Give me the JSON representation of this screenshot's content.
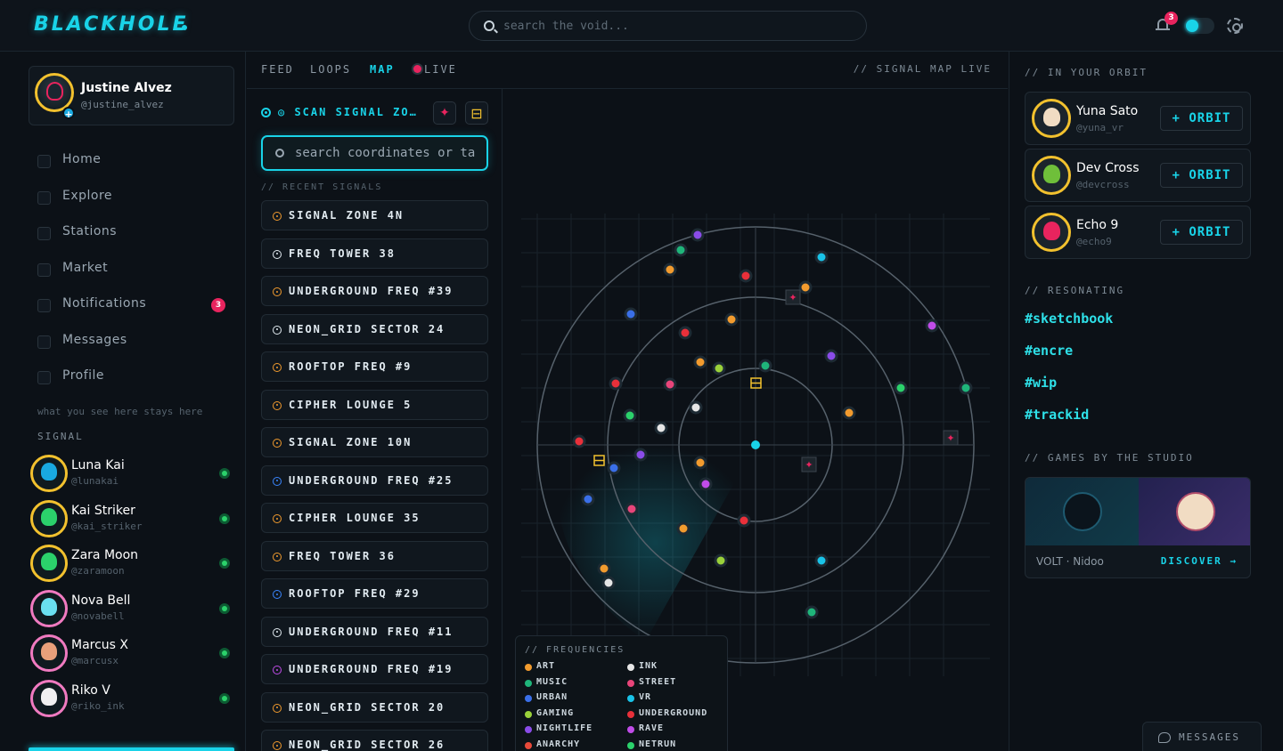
{
  "app": {
    "logo": "BLACKHOLE"
  },
  "search": {
    "placeholder": "search the void..."
  },
  "header": {
    "notifications_count": "3"
  },
  "user": {
    "name": "Justine Alvez",
    "handle": "@justine_alvez"
  },
  "nav": [
    {
      "label": "Home"
    },
    {
      "label": "Explore"
    },
    {
      "label": "Stations"
    },
    {
      "label": "Market"
    },
    {
      "label": "Notifications",
      "badge": "3"
    },
    {
      "label": "Messages"
    },
    {
      "label": "Profile"
    }
  ],
  "tagline": "what you see here stays here",
  "signal_section": "SIGNAL",
  "friends": [
    {
      "name": "Luna Kai",
      "handle": "@lunakai",
      "color": "#19a9e0"
    },
    {
      "name": "Kai Striker",
      "handle": "@kai_striker",
      "color": "#2bd16b"
    },
    {
      "name": "Zara Moon",
      "handle": "@zaramoon",
      "color": "#2bd16b"
    },
    {
      "name": "Nova Bell",
      "handle": "@novabell",
      "color": "#6ae0f0"
    },
    {
      "name": "Marcus X",
      "handle": "@marcusx",
      "color": "#e8a07a"
    },
    {
      "name": "Riko V",
      "handle": "@riko_ink",
      "color": "#f0f0f0"
    }
  ],
  "tabs": {
    "feed": "FEED",
    "loops": "LOOPS",
    "map": "MAP",
    "live": "LIVE",
    "map_live": "// SIGNAL MAP LIVE"
  },
  "scan": {
    "label": "◎ SCAN SIGNAL ZO…",
    "add_icon": "✦",
    "grid_icon": "⊟"
  },
  "coord_search": {
    "placeholder": "search coordinates or ta"
  },
  "recent_head": "// RECENT SIGNALS",
  "signals": [
    {
      "label": "SIGNAL ZONE 4N",
      "color": "#f29b2e"
    },
    {
      "label": "FREQ TOWER 38",
      "color": "#e2ebf1"
    },
    {
      "label": "UNDERGROUND FREQ #39",
      "color": "#f29b2e"
    },
    {
      "label": "NEON_GRID SECTOR 24",
      "color": "#e2ebf1"
    },
    {
      "label": "ROOFTOP FREQ #9",
      "color": "#f29b2e"
    },
    {
      "label": "CIPHER LOUNGE 5",
      "color": "#f29b2e"
    },
    {
      "label": "SIGNAL ZONE 10N",
      "color": "#f29b2e"
    },
    {
      "label": "UNDERGROUND FREQ #25",
      "color": "#3a86ff"
    },
    {
      "label": "CIPHER LOUNGE 35",
      "color": "#f29b2e"
    },
    {
      "label": "FREQ TOWER 36",
      "color": "#f29b2e"
    },
    {
      "label": "ROOFTOP FREQ #29",
      "color": "#3a86ff"
    },
    {
      "label": "UNDERGROUND FREQ #11",
      "color": "#e2ebf1"
    },
    {
      "label": "UNDERGROUND FREQ #19",
      "color": "#c04ce8"
    },
    {
      "label": "NEON_GRID SECTOR 20",
      "color": "#f29b2e"
    },
    {
      "label": "NEON_GRID SECTOR 26",
      "color": "#f29b2e"
    }
  ],
  "legend": {
    "title": "// FREQUENCIES",
    "items": [
      {
        "label": "ART",
        "color": "#f29b2e"
      },
      {
        "label": "INK",
        "color": "#e6e6e6"
      },
      {
        "label": "MUSIC",
        "color": "#1fb57a"
      },
      {
        "label": "STREET",
        "color": "#e8457a"
      },
      {
        "label": "URBAN",
        "color": "#3a6fe8"
      },
      {
        "label": "VR",
        "color": "#19c3e8"
      },
      {
        "label": "GAMING",
        "color": "#9ad13a"
      },
      {
        "label": "UNDERGROUND",
        "color": "#e8303a"
      },
      {
        "label": "NIGHTLIFE",
        "color": "#8a4ce8"
      },
      {
        "label": "RAVE",
        "color": "#c04ce8"
      },
      {
        "label": "ANARCHY",
        "color": "#e84a3a"
      },
      {
        "label": "NETRUN",
        "color": "#2bd16b"
      }
    ]
  },
  "orbit_head": "// IN YOUR ORBIT",
  "orbit": [
    {
      "name": "Yuna Sato",
      "handle": "@yuna_vr",
      "button": "+ ORBIT",
      "color": "#f1dcc3"
    },
    {
      "name": "Dev Cross",
      "handle": "@devcross",
      "button": "+ ORBIT",
      "color": "#6fbf3a"
    },
    {
      "name": "Echo 9",
      "handle": "@echo9",
      "button": "+ ORBIT",
      "color": "#e8245e"
    }
  ],
  "resonating_head": "// RESONATING",
  "tags": [
    "#sketchbook",
    "#encre",
    "#wip",
    "#trackid"
  ],
  "games_head": "// GAMES BY THE STUDIO",
  "game": {
    "label": "VOLT · Nidoo",
    "discover": "DISCOVER →"
  },
  "messages_btn": "MESSAGES"
}
